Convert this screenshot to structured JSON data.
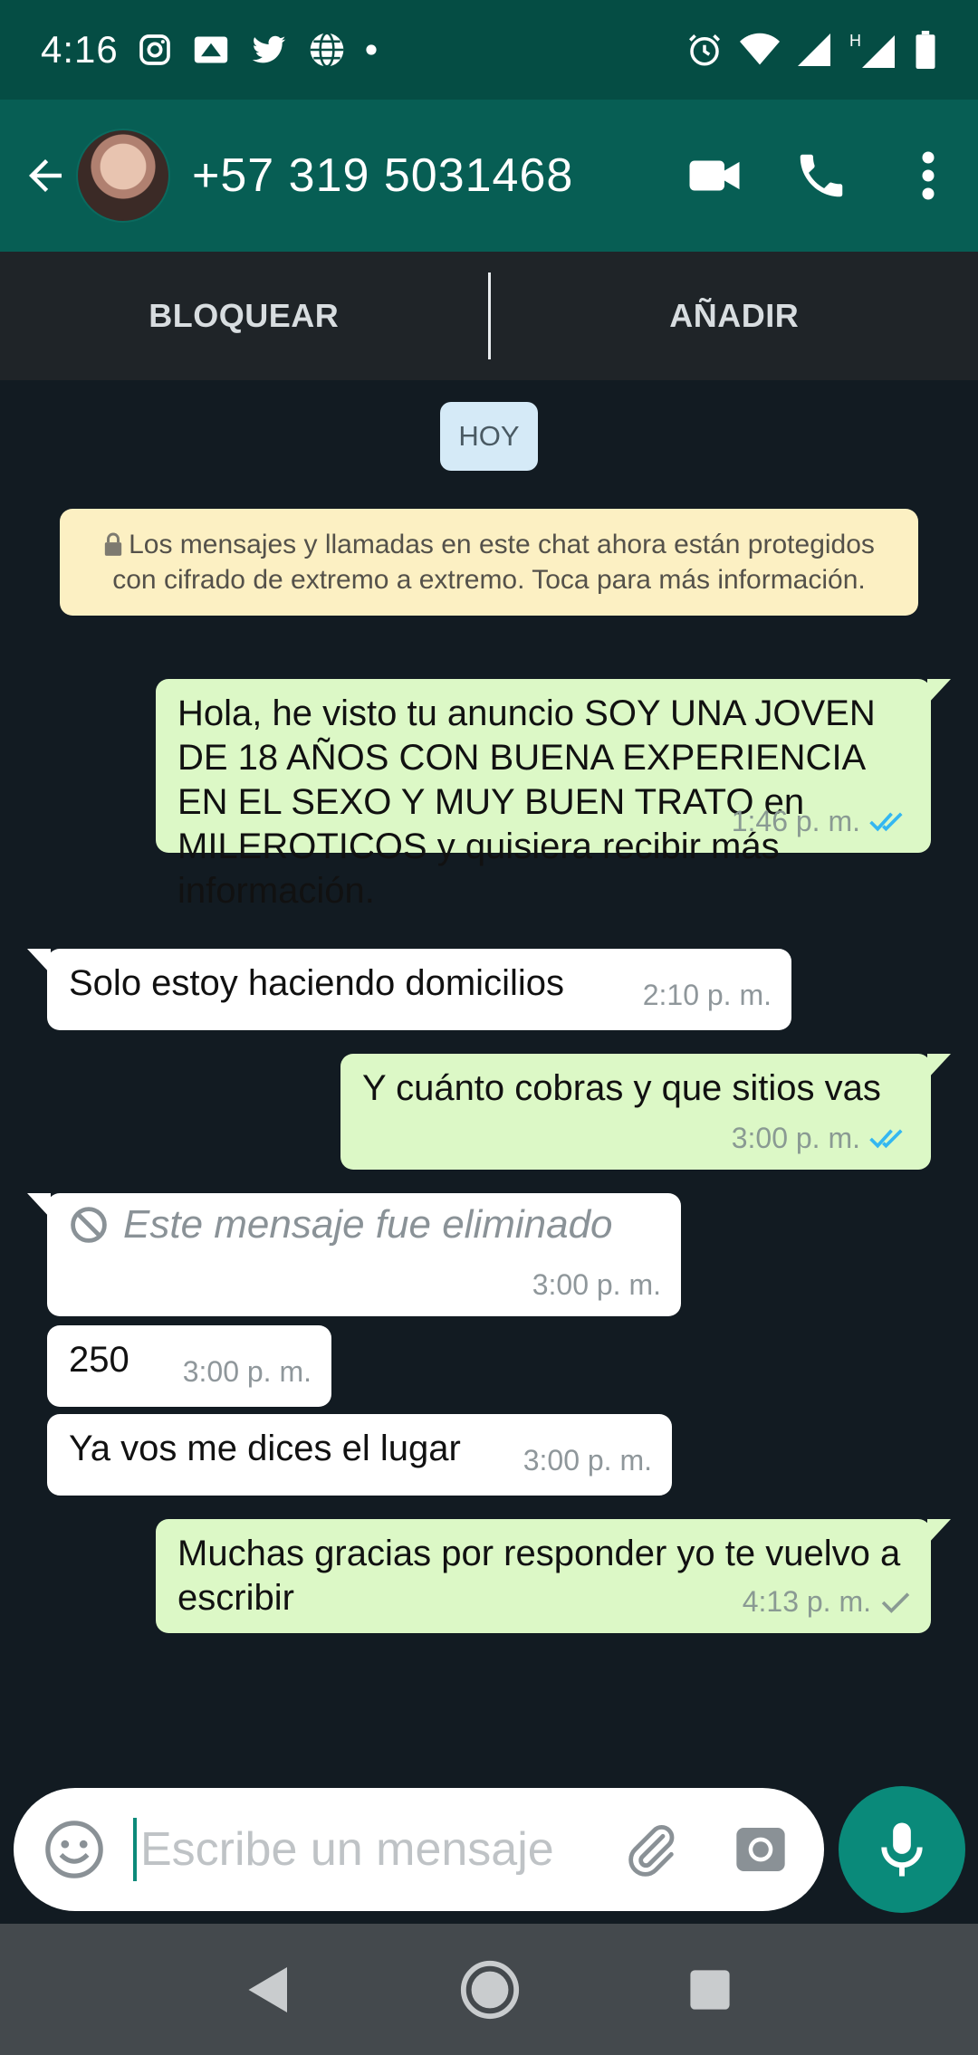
{
  "status_bar": {
    "time": "4:16"
  },
  "header": {
    "contact_name": "+57 319 5031468"
  },
  "actions": {
    "block": "BLOQUEAR",
    "add": "AÑADIR"
  },
  "chat": {
    "date_label": "HOY",
    "system_message": "Los mensajes y llamadas en este chat ahora están protegidos con cifrado de extremo a extremo. Toca para más información.",
    "messages": [
      {
        "direction": "out",
        "text": "Hola, he visto tu anuncio SOY UNA JOVEN DE 18 AÑOS CON BUENA EXPERIENCIA EN EL SEXO Y MUY BUEN TRATO en MILEROTICOS y quisiera recibir más información.",
        "time": "1:46 p. m.",
        "status": "read"
      },
      {
        "direction": "in",
        "text": "Solo estoy haciendo domicilios",
        "time": "2:10 p. m."
      },
      {
        "direction": "out",
        "text": "Y cuánto cobras y que sitios vas",
        "time": "3:00 p. m.",
        "status": "read"
      },
      {
        "direction": "in",
        "text": "Este mensaje fue eliminado",
        "time": "3:00 p. m.",
        "deleted": true
      },
      {
        "direction": "in",
        "text": "250",
        "time": "3:00 p. m."
      },
      {
        "direction": "in",
        "text": "Ya vos me dices el lugar",
        "time": "3:00 p. m."
      },
      {
        "direction": "out",
        "text": "Muchas gracias por responder yo te vuelvo a escribir",
        "time": "4:13 p. m.",
        "status": "sent"
      }
    ]
  },
  "composer": {
    "placeholder": "Escribe un mensaje"
  },
  "colors": {
    "header": "#075e54",
    "status_bar": "#054d44",
    "outgoing_bubble": "#dcf8c6",
    "incoming_bubble": "#ffffff",
    "read_ticks": "#34b7f1",
    "mic_button": "#0a8a7a"
  },
  "icons": [
    "back-arrow-icon",
    "video-call-icon",
    "phone-icon",
    "more-vert-icon",
    "lock-icon",
    "blocked-icon",
    "emoji-icon",
    "attach-icon",
    "camera-icon",
    "mic-icon"
  ]
}
